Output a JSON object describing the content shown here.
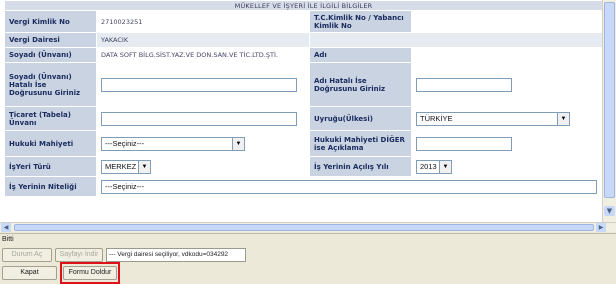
{
  "form": {
    "header": "MÜKELLEF VE İŞYERİ İLE İLGİLİ BİLGİLER",
    "vergi_kimlik_no": {
      "label": "Vergi Kimlik No",
      "value": "2710023251"
    },
    "tc_kimlik": {
      "label": "T.C.Kimlik No / Yabancı Kimlik No",
      "value": ""
    },
    "vergi_dairesi": {
      "label": "Vergi Dairesi",
      "value": "YAKACIK"
    },
    "soyadi": {
      "label": "Soyadı (Ünvanı)",
      "value": "DATA SOFT BİLG.SİST.YAZ.VE DON.SAN.VE TİC.LTD.ŞTİ."
    },
    "adi": {
      "label": "Adı",
      "value": ""
    },
    "soyadi_hatali": {
      "label": "Soyadı (Ünvanı) Hatalı İse Doğrusunu Giriniz",
      "value": ""
    },
    "adi_hatali": {
      "label": "Adı Hatalı İse Doğrusunu Giriniz",
      "value": ""
    },
    "ticaret": {
      "label": "Ticaret (Tabela) Ünvanı",
      "value": ""
    },
    "uyrugu": {
      "label": "Uyruğu(Ülkesi)",
      "value": "TÜRKİYE"
    },
    "hukuki_mahiyeti": {
      "label": "Hukuki Mahiyeti",
      "value": "---Seçiniz---"
    },
    "hukuki_diger": {
      "label": "Hukuki Mahiyeti DİĞER ise Açıklama",
      "value": ""
    },
    "isyeri_turu": {
      "label": "İşYeri Türü",
      "value": "MERKEZ"
    },
    "acilis_yili": {
      "label": "İş Yerinin Açılış Yılı",
      "value": "2013"
    },
    "niteligi": {
      "label": "İş Yerinin Niteliği",
      "value": "---Seçiniz---"
    }
  },
  "status_bar": {
    "text": "Bitti"
  },
  "toolbar": {
    "durum_ac": "Durum Aç",
    "sayfayi_indir": "Sayfayı İndir",
    "message": "--- Vergi dairesi seçiliyor, vdkodu=034292",
    "kapat": "Kapat",
    "formu_doldur": "Formu Doldur"
  },
  "colors": {
    "label_bg": "#c9d3e1",
    "highlight": "#e0101a"
  }
}
